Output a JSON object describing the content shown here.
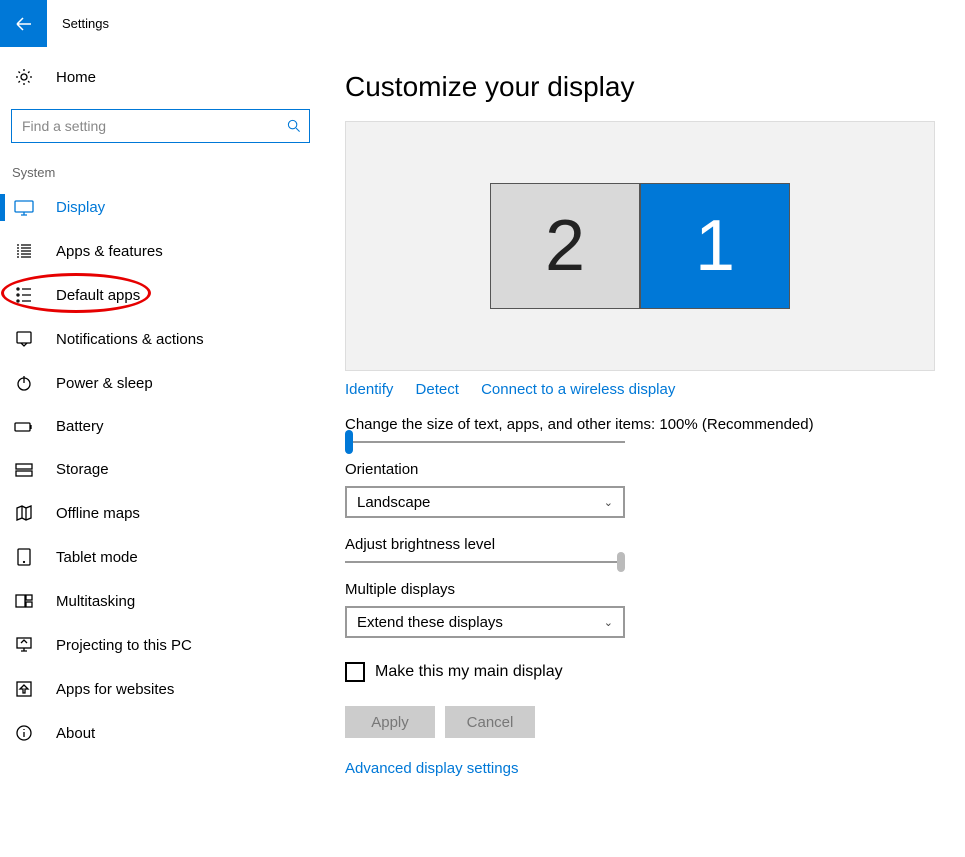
{
  "titlebar": {
    "title": "Settings"
  },
  "sidebar": {
    "home": "Home",
    "search_placeholder": "Find a setting",
    "section": "System",
    "items": [
      {
        "label": "Display",
        "active": true,
        "icon": "display-icon"
      },
      {
        "label": "Apps & features",
        "icon": "apps-icon"
      },
      {
        "label": "Default apps",
        "icon": "default-apps-icon",
        "circled": true
      },
      {
        "label": "Notifications & actions",
        "icon": "notifications-icon"
      },
      {
        "label": "Power & sleep",
        "icon": "power-icon"
      },
      {
        "label": "Battery",
        "icon": "battery-icon"
      },
      {
        "label": "Storage",
        "icon": "storage-icon"
      },
      {
        "label": "Offline maps",
        "icon": "map-icon"
      },
      {
        "label": "Tablet mode",
        "icon": "tablet-icon"
      },
      {
        "label": "Multitasking",
        "icon": "multitask-icon"
      },
      {
        "label": "Projecting to this PC",
        "icon": "project-icon"
      },
      {
        "label": "Apps for websites",
        "icon": "apps-web-icon"
      },
      {
        "label": "About",
        "icon": "about-icon"
      }
    ]
  },
  "main": {
    "heading": "Customize your display",
    "monitors": {
      "left": "2",
      "right": "1"
    },
    "links": {
      "identify": "Identify",
      "detect": "Detect",
      "wireless": "Connect to a wireless display"
    },
    "scale_label": "Change the size of text, apps, and other items: 100% (Recommended)",
    "orientation_label": "Orientation",
    "orientation_value": "Landscape",
    "brightness_label": "Adjust brightness level",
    "multiple_label": "Multiple displays",
    "multiple_value": "Extend these displays",
    "main_display_check": "Make this my main display",
    "apply": "Apply",
    "cancel": "Cancel",
    "advanced": "Advanced display settings"
  }
}
